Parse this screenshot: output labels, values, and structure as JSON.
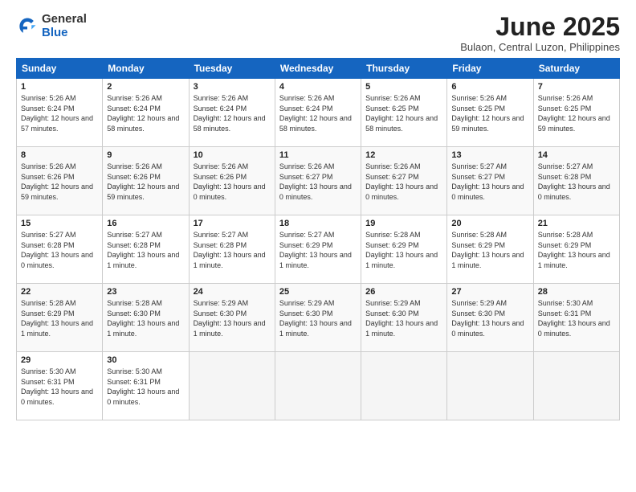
{
  "header": {
    "logo_general": "General",
    "logo_blue": "Blue",
    "month_title": "June 2025",
    "location": "Bulaon, Central Luzon, Philippines"
  },
  "columns": [
    "Sunday",
    "Monday",
    "Tuesday",
    "Wednesday",
    "Thursday",
    "Friday",
    "Saturday"
  ],
  "weeks": [
    [
      {
        "day": "1",
        "sunrise": "Sunrise: 5:26 AM",
        "sunset": "Sunset: 6:24 PM",
        "daylight": "Daylight: 12 hours and 57 minutes."
      },
      {
        "day": "2",
        "sunrise": "Sunrise: 5:26 AM",
        "sunset": "Sunset: 6:24 PM",
        "daylight": "Daylight: 12 hours and 58 minutes."
      },
      {
        "day": "3",
        "sunrise": "Sunrise: 5:26 AM",
        "sunset": "Sunset: 6:24 PM",
        "daylight": "Daylight: 12 hours and 58 minutes."
      },
      {
        "day": "4",
        "sunrise": "Sunrise: 5:26 AM",
        "sunset": "Sunset: 6:24 PM",
        "daylight": "Daylight: 12 hours and 58 minutes."
      },
      {
        "day": "5",
        "sunrise": "Sunrise: 5:26 AM",
        "sunset": "Sunset: 6:25 PM",
        "daylight": "Daylight: 12 hours and 58 minutes."
      },
      {
        "day": "6",
        "sunrise": "Sunrise: 5:26 AM",
        "sunset": "Sunset: 6:25 PM",
        "daylight": "Daylight: 12 hours and 59 minutes."
      },
      {
        "day": "7",
        "sunrise": "Sunrise: 5:26 AM",
        "sunset": "Sunset: 6:25 PM",
        "daylight": "Daylight: 12 hours and 59 minutes."
      }
    ],
    [
      {
        "day": "8",
        "sunrise": "Sunrise: 5:26 AM",
        "sunset": "Sunset: 6:26 PM",
        "daylight": "Daylight: 12 hours and 59 minutes."
      },
      {
        "day": "9",
        "sunrise": "Sunrise: 5:26 AM",
        "sunset": "Sunset: 6:26 PM",
        "daylight": "Daylight: 12 hours and 59 minutes."
      },
      {
        "day": "10",
        "sunrise": "Sunrise: 5:26 AM",
        "sunset": "Sunset: 6:26 PM",
        "daylight": "Daylight: 13 hours and 0 minutes."
      },
      {
        "day": "11",
        "sunrise": "Sunrise: 5:26 AM",
        "sunset": "Sunset: 6:27 PM",
        "daylight": "Daylight: 13 hours and 0 minutes."
      },
      {
        "day": "12",
        "sunrise": "Sunrise: 5:26 AM",
        "sunset": "Sunset: 6:27 PM",
        "daylight": "Daylight: 13 hours and 0 minutes."
      },
      {
        "day": "13",
        "sunrise": "Sunrise: 5:27 AM",
        "sunset": "Sunset: 6:27 PM",
        "daylight": "Daylight: 13 hours and 0 minutes."
      },
      {
        "day": "14",
        "sunrise": "Sunrise: 5:27 AM",
        "sunset": "Sunset: 6:28 PM",
        "daylight": "Daylight: 13 hours and 0 minutes."
      }
    ],
    [
      {
        "day": "15",
        "sunrise": "Sunrise: 5:27 AM",
        "sunset": "Sunset: 6:28 PM",
        "daylight": "Daylight: 13 hours and 0 minutes."
      },
      {
        "day": "16",
        "sunrise": "Sunrise: 5:27 AM",
        "sunset": "Sunset: 6:28 PM",
        "daylight": "Daylight: 13 hours and 1 minute."
      },
      {
        "day": "17",
        "sunrise": "Sunrise: 5:27 AM",
        "sunset": "Sunset: 6:28 PM",
        "daylight": "Daylight: 13 hours and 1 minute."
      },
      {
        "day": "18",
        "sunrise": "Sunrise: 5:27 AM",
        "sunset": "Sunset: 6:29 PM",
        "daylight": "Daylight: 13 hours and 1 minute."
      },
      {
        "day": "19",
        "sunrise": "Sunrise: 5:28 AM",
        "sunset": "Sunset: 6:29 PM",
        "daylight": "Daylight: 13 hours and 1 minute."
      },
      {
        "day": "20",
        "sunrise": "Sunrise: 5:28 AM",
        "sunset": "Sunset: 6:29 PM",
        "daylight": "Daylight: 13 hours and 1 minute."
      },
      {
        "day": "21",
        "sunrise": "Sunrise: 5:28 AM",
        "sunset": "Sunset: 6:29 PM",
        "daylight": "Daylight: 13 hours and 1 minute."
      }
    ],
    [
      {
        "day": "22",
        "sunrise": "Sunrise: 5:28 AM",
        "sunset": "Sunset: 6:29 PM",
        "daylight": "Daylight: 13 hours and 1 minute."
      },
      {
        "day": "23",
        "sunrise": "Sunrise: 5:28 AM",
        "sunset": "Sunset: 6:30 PM",
        "daylight": "Daylight: 13 hours and 1 minute."
      },
      {
        "day": "24",
        "sunrise": "Sunrise: 5:29 AM",
        "sunset": "Sunset: 6:30 PM",
        "daylight": "Daylight: 13 hours and 1 minute."
      },
      {
        "day": "25",
        "sunrise": "Sunrise: 5:29 AM",
        "sunset": "Sunset: 6:30 PM",
        "daylight": "Daylight: 13 hours and 1 minute."
      },
      {
        "day": "26",
        "sunrise": "Sunrise: 5:29 AM",
        "sunset": "Sunset: 6:30 PM",
        "daylight": "Daylight: 13 hours and 1 minute."
      },
      {
        "day": "27",
        "sunrise": "Sunrise: 5:29 AM",
        "sunset": "Sunset: 6:30 PM",
        "daylight": "Daylight: 13 hours and 0 minutes."
      },
      {
        "day": "28",
        "sunrise": "Sunrise: 5:30 AM",
        "sunset": "Sunset: 6:31 PM",
        "daylight": "Daylight: 13 hours and 0 minutes."
      }
    ],
    [
      {
        "day": "29",
        "sunrise": "Sunrise: 5:30 AM",
        "sunset": "Sunset: 6:31 PM",
        "daylight": "Daylight: 13 hours and 0 minutes."
      },
      {
        "day": "30",
        "sunrise": "Sunrise: 5:30 AM",
        "sunset": "Sunset: 6:31 PM",
        "daylight": "Daylight: 13 hours and 0 minutes."
      },
      null,
      null,
      null,
      null,
      null
    ]
  ]
}
